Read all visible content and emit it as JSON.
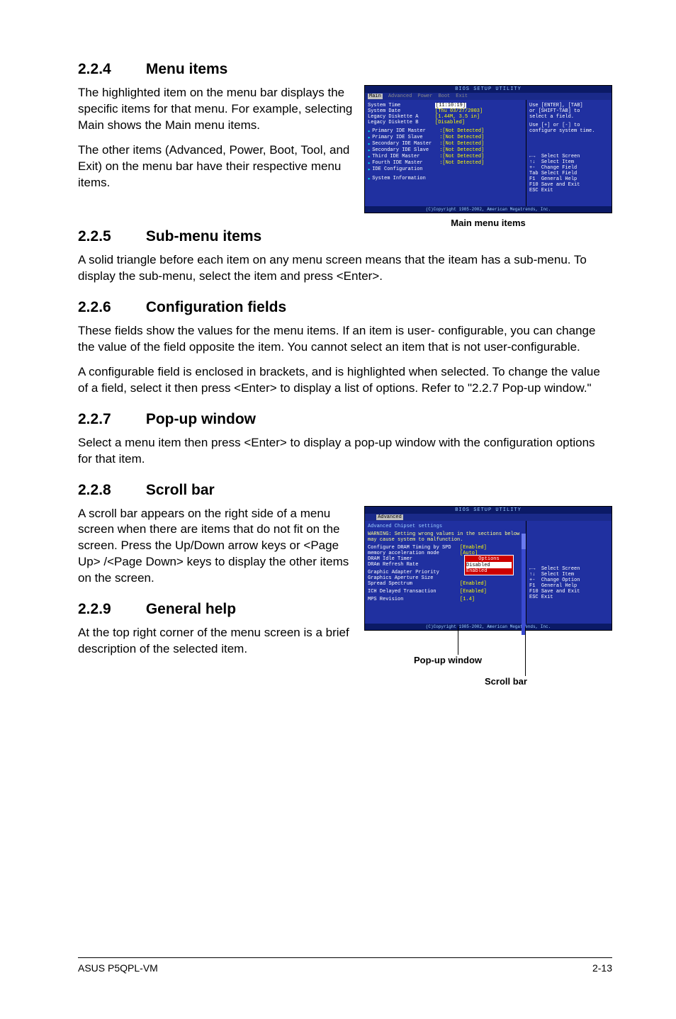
{
  "sections": {
    "s224": {
      "num": "2.2.4",
      "title": "Menu items",
      "p1": "The highlighted item on the menu bar displays the specific items for that menu. For example, selecting Main shows the Main menu items.",
      "p2": "The other items (Advanced, Power, Boot, Tool, and Exit) on the menu bar have their respective menu items."
    },
    "s225": {
      "num": "2.2.5",
      "title": "Sub-menu items",
      "p1": "A solid triangle before each item on any menu screen means that the iteam has a sub-menu. To display the sub-menu, select the item and press <Enter>."
    },
    "s226": {
      "num": "2.2.6",
      "title": "Configuration fields",
      "p1": "These fields show the values for the menu items. If an item is user- configurable, you can change the value of the field opposite the item. You cannot select an item that is not user-configurable.",
      "p2": "A configurable field is enclosed in brackets, and is highlighted when selected. To change the value of a field, select it then press <Enter> to display a list of options. Refer to \"2.2.7 Pop-up window.\""
    },
    "s227": {
      "num": "2.2.7",
      "title": "Pop-up window",
      "p1": "Select a menu item then press <Enter> to display a pop-up window with the configuration options for that item."
    },
    "s228": {
      "num": "2.2.8",
      "title": "Scroll bar",
      "p1": "A scroll bar appears on the right side of a menu screen when there are items that do not fit on the screen. Press the Up/Down arrow keys or <Page Up> /<Page Down> keys to display the other items on the screen."
    },
    "s229": {
      "num": "2.2.9",
      "title": "General help",
      "p1": "At the top right corner of the menu screen is a brief description of the selected item."
    }
  },
  "captions": {
    "main_menu": "Main menu items",
    "popup": "Pop-up window",
    "scrollbar": "Scroll bar"
  },
  "bios1": {
    "title": "BIOS SETUP UTILITY",
    "tabs": {
      "main": "Main",
      "advanced": "Advanced",
      "power": "Power",
      "boot": "Boot",
      "exit": "Exit"
    },
    "rows": {
      "r1k": "System Time",
      "r1v": "[11:10:19]",
      "r2k": "System Date",
      "r2v": "[Thu 03/27/2003]",
      "r3k": "Legacy Diskette A",
      "r3v": "[1.44M, 3.5 in]",
      "r4k": "Legacy Diskette B",
      "r4v": "[Disabled]",
      "r5k": "Primary IDE Master",
      "r5v": ":[Not Detected]",
      "r6k": "Primary IDE Slave",
      "r6v": ":[Not Detected]",
      "r7k": "Secondary IDE Master",
      "r7v": ":[Not Detected]",
      "r8k": "Secondary IDE Slave",
      "r8v": ":[Not Detected]",
      "r9k": "Third IDE Master",
      "r9v": ":[Not Detected]",
      "r10k": "Fourth IDE Master",
      "r10v": ":[Not Detected]",
      "r11k": "IDE Configuration",
      "r12k": "System Information"
    },
    "help": {
      "h1": "Use [ENTER], [TAB]",
      "h2": "or [SHIFT-TAB] to",
      "h3": "select a field.",
      "h4": "Use [+] or [-] to",
      "h5": "configure system time.",
      "n1": "Select Screen",
      "n2": "Select Item",
      "n3": "Change Field",
      "n4": "Select Field",
      "n5": "General Help",
      "n6": "Save and Exit",
      "n7": "Exit",
      "k1": "←→",
      "k2": "↑↓",
      "k3": "+-",
      "k4": "Tab",
      "k5": "F1",
      "k6": "F10",
      "k7": "ESC"
    },
    "foot": "(C)Copyright 1985-2002, American Megatrends, Inc."
  },
  "bios2": {
    "title": "BIOS SETUP UTILITY",
    "tab": "Advanced",
    "head": "Advanced Chipset settings",
    "warn": "WARNING: Setting wrong values in the sections below may cause system to malfunction.",
    "rows": {
      "r1k": "Configure DRAM Timing by SPD",
      "r1v": "[Enabled]",
      "r2k": "memory acceleration mode",
      "r2v": "[Auto]",
      "r3k": "DRAM Idle Timer",
      "r3v": "",
      "r4k": "DRAm Refresh Rate",
      "r4v": "",
      "r5k": "Graphic Adapter Priority",
      "r5v": "",
      "r6k": "Graphics Aperture Size",
      "r6v": "",
      "r7k": "Spread Spectrum",
      "r7v": "[Enabled]",
      "r8k": "ICH Delayed Transaction",
      "r8v": "[Enabled]",
      "r9k": "MPS Revision",
      "r9v": "[1.4]"
    },
    "popup": {
      "head": "Options",
      "o1": "Disabled",
      "o2": "Enabled"
    },
    "help": {
      "n1": "Select Screen",
      "n2": "Select Item",
      "n3": "Change Option",
      "n4": "General Help",
      "n5": "Save and Exit",
      "n6": "Exit",
      "k1": "←→",
      "k2": "↑↓",
      "k3": "+-",
      "k4": "F1",
      "k5": "F10",
      "k6": "ESC"
    },
    "foot": "(C)Copyright 1985-2002, American Megatrends, Inc."
  },
  "footer": {
    "left": "ASUS P5QPL-VM",
    "right": "2-13"
  }
}
